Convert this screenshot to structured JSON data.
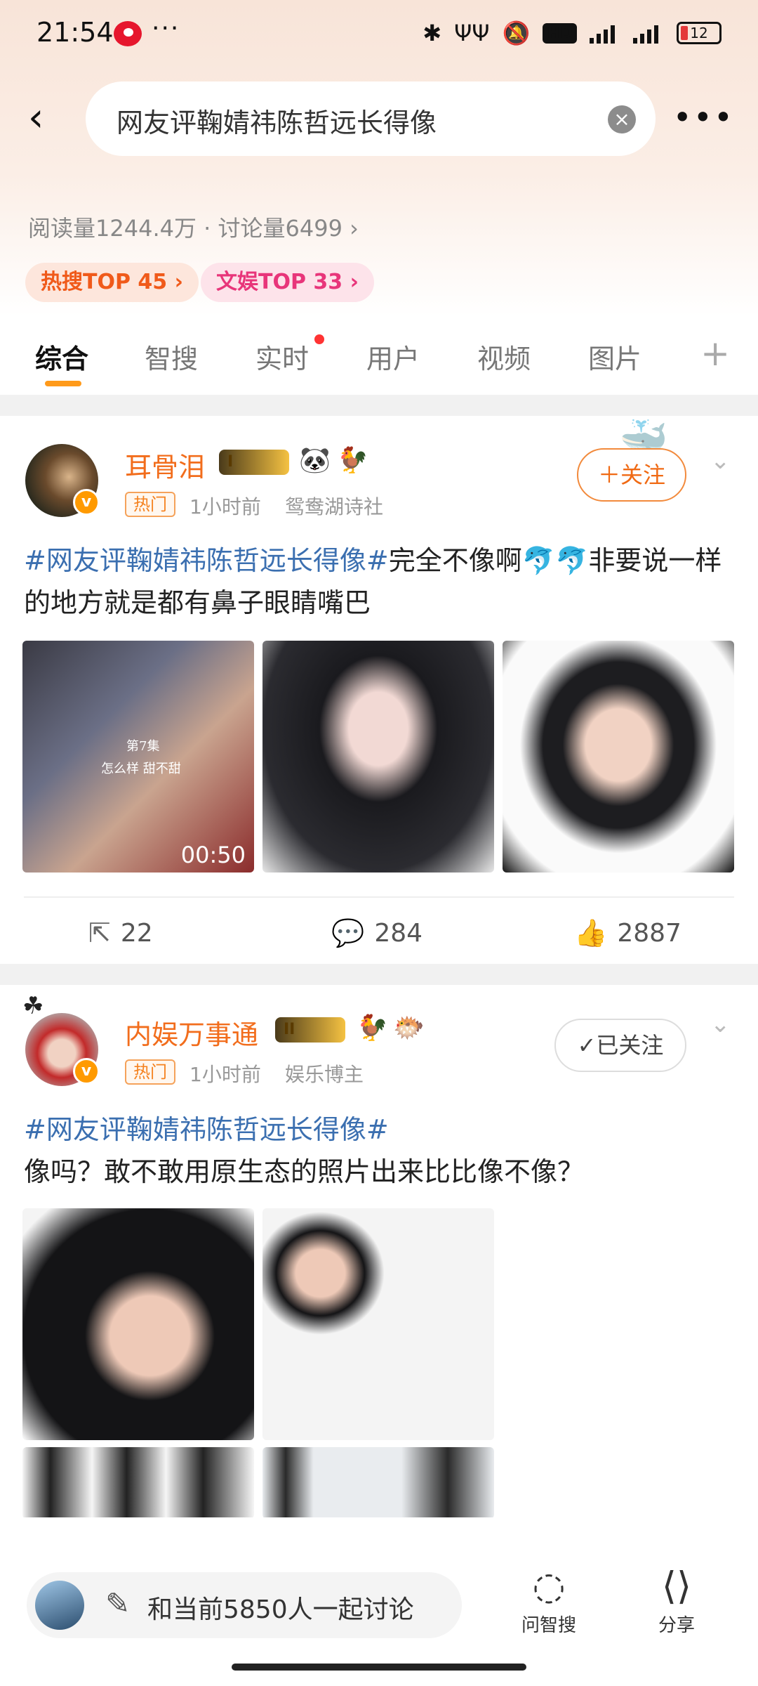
{
  "status_bar": {
    "time": "21:54",
    "dots": "···",
    "battery": "12"
  },
  "search": {
    "query": "网友评鞠婧祎陈哲远长得像"
  },
  "stats": "阅读量1244.4万 · 讨论量6499 ›",
  "tags": [
    {
      "label": "热搜TOP 45 ›"
    },
    {
      "label": "文娱TOP 33 ›"
    }
  ],
  "tabs": [
    {
      "label": "综合"
    },
    {
      "label": "智搜"
    },
    {
      "label": "实时"
    },
    {
      "label": "用户"
    },
    {
      "label": "视频"
    },
    {
      "label": "图片"
    }
  ],
  "posts": [
    {
      "username": "耳骨泪",
      "level": "I",
      "hot_label": "热门",
      "time": "1小时前",
      "source": "鸳鸯湖诗社",
      "follow_label": "＋关注",
      "hashtag": "#网友评鞠婧祎陈哲远长得像#",
      "text": "完全不像啊🐬🐬非要说一样的地方就是都有鼻子眼睛嘴巴",
      "video_duration": "00:50",
      "video_caption1": "第7集",
      "video_caption2": "怎么样 甜不甜",
      "reposts": "22",
      "comments": "284",
      "likes": "2887"
    },
    {
      "username": "内娱万事通",
      "level": "II",
      "hot_label": "热门",
      "time": "1小时前",
      "source": "娱乐博主",
      "follow_label": "✓已关注",
      "hashtag": "#网友评鞠婧祎陈哲远长得像#",
      "text": "像吗？敢不敢用原生态的照片出来比比像不像？"
    }
  ],
  "bottom_bar": {
    "input_label": "和当前5850人一起讨论",
    "ask_label": "问智搜",
    "share_label": "分享"
  }
}
